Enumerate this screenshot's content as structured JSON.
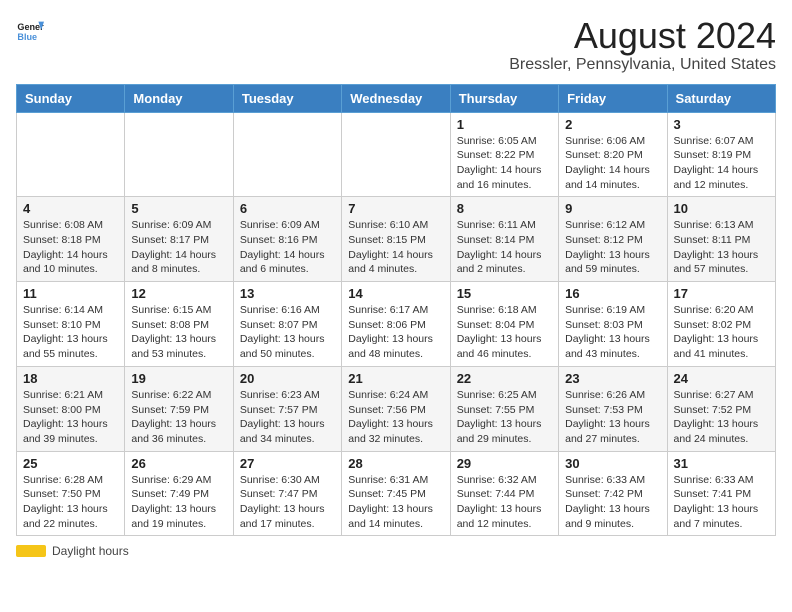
{
  "logo": {
    "line1": "General",
    "line2": "Blue"
  },
  "title": "August 2024",
  "subtitle": "Bressler, Pennsylvania, United States",
  "days_of_week": [
    "Sunday",
    "Monday",
    "Tuesday",
    "Wednesday",
    "Thursday",
    "Friday",
    "Saturday"
  ],
  "footer": {
    "label": "Daylight hours"
  },
  "weeks": [
    {
      "row_bg": "white",
      "days": [
        {
          "num": "",
          "info": ""
        },
        {
          "num": "",
          "info": ""
        },
        {
          "num": "",
          "info": ""
        },
        {
          "num": "",
          "info": ""
        },
        {
          "num": "1",
          "info": "Sunrise: 6:05 AM\nSunset: 8:22 PM\nDaylight: 14 hours\nand 16 minutes."
        },
        {
          "num": "2",
          "info": "Sunrise: 6:06 AM\nSunset: 8:20 PM\nDaylight: 14 hours\nand 14 minutes."
        },
        {
          "num": "3",
          "info": "Sunrise: 6:07 AM\nSunset: 8:19 PM\nDaylight: 14 hours\nand 12 minutes."
        }
      ]
    },
    {
      "row_bg": "light",
      "days": [
        {
          "num": "4",
          "info": "Sunrise: 6:08 AM\nSunset: 8:18 PM\nDaylight: 14 hours\nand 10 minutes."
        },
        {
          "num": "5",
          "info": "Sunrise: 6:09 AM\nSunset: 8:17 PM\nDaylight: 14 hours\nand 8 minutes."
        },
        {
          "num": "6",
          "info": "Sunrise: 6:09 AM\nSunset: 8:16 PM\nDaylight: 14 hours\nand 6 minutes."
        },
        {
          "num": "7",
          "info": "Sunrise: 6:10 AM\nSunset: 8:15 PM\nDaylight: 14 hours\nand 4 minutes."
        },
        {
          "num": "8",
          "info": "Sunrise: 6:11 AM\nSunset: 8:14 PM\nDaylight: 14 hours\nand 2 minutes."
        },
        {
          "num": "9",
          "info": "Sunrise: 6:12 AM\nSunset: 8:12 PM\nDaylight: 13 hours\nand 59 minutes."
        },
        {
          "num": "10",
          "info": "Sunrise: 6:13 AM\nSunset: 8:11 PM\nDaylight: 13 hours\nand 57 minutes."
        }
      ]
    },
    {
      "row_bg": "white",
      "days": [
        {
          "num": "11",
          "info": "Sunrise: 6:14 AM\nSunset: 8:10 PM\nDaylight: 13 hours\nand 55 minutes."
        },
        {
          "num": "12",
          "info": "Sunrise: 6:15 AM\nSunset: 8:08 PM\nDaylight: 13 hours\nand 53 minutes."
        },
        {
          "num": "13",
          "info": "Sunrise: 6:16 AM\nSunset: 8:07 PM\nDaylight: 13 hours\nand 50 minutes."
        },
        {
          "num": "14",
          "info": "Sunrise: 6:17 AM\nSunset: 8:06 PM\nDaylight: 13 hours\nand 48 minutes."
        },
        {
          "num": "15",
          "info": "Sunrise: 6:18 AM\nSunset: 8:04 PM\nDaylight: 13 hours\nand 46 minutes."
        },
        {
          "num": "16",
          "info": "Sunrise: 6:19 AM\nSunset: 8:03 PM\nDaylight: 13 hours\nand 43 minutes."
        },
        {
          "num": "17",
          "info": "Sunrise: 6:20 AM\nSunset: 8:02 PM\nDaylight: 13 hours\nand 41 minutes."
        }
      ]
    },
    {
      "row_bg": "light",
      "days": [
        {
          "num": "18",
          "info": "Sunrise: 6:21 AM\nSunset: 8:00 PM\nDaylight: 13 hours\nand 39 minutes."
        },
        {
          "num": "19",
          "info": "Sunrise: 6:22 AM\nSunset: 7:59 PM\nDaylight: 13 hours\nand 36 minutes."
        },
        {
          "num": "20",
          "info": "Sunrise: 6:23 AM\nSunset: 7:57 PM\nDaylight: 13 hours\nand 34 minutes."
        },
        {
          "num": "21",
          "info": "Sunrise: 6:24 AM\nSunset: 7:56 PM\nDaylight: 13 hours\nand 32 minutes."
        },
        {
          "num": "22",
          "info": "Sunrise: 6:25 AM\nSunset: 7:55 PM\nDaylight: 13 hours\nand 29 minutes."
        },
        {
          "num": "23",
          "info": "Sunrise: 6:26 AM\nSunset: 7:53 PM\nDaylight: 13 hours\nand 27 minutes."
        },
        {
          "num": "24",
          "info": "Sunrise: 6:27 AM\nSunset: 7:52 PM\nDaylight: 13 hours\nand 24 minutes."
        }
      ]
    },
    {
      "row_bg": "white",
      "days": [
        {
          "num": "25",
          "info": "Sunrise: 6:28 AM\nSunset: 7:50 PM\nDaylight: 13 hours\nand 22 minutes."
        },
        {
          "num": "26",
          "info": "Sunrise: 6:29 AM\nSunset: 7:49 PM\nDaylight: 13 hours\nand 19 minutes."
        },
        {
          "num": "27",
          "info": "Sunrise: 6:30 AM\nSunset: 7:47 PM\nDaylight: 13 hours\nand 17 minutes."
        },
        {
          "num": "28",
          "info": "Sunrise: 6:31 AM\nSunset: 7:45 PM\nDaylight: 13 hours\nand 14 minutes."
        },
        {
          "num": "29",
          "info": "Sunrise: 6:32 AM\nSunset: 7:44 PM\nDaylight: 13 hours\nand 12 minutes."
        },
        {
          "num": "30",
          "info": "Sunrise: 6:33 AM\nSunset: 7:42 PM\nDaylight: 13 hours\nand 9 minutes."
        },
        {
          "num": "31",
          "info": "Sunrise: 6:33 AM\nSunset: 7:41 PM\nDaylight: 13 hours\nand 7 minutes."
        }
      ]
    }
  ]
}
